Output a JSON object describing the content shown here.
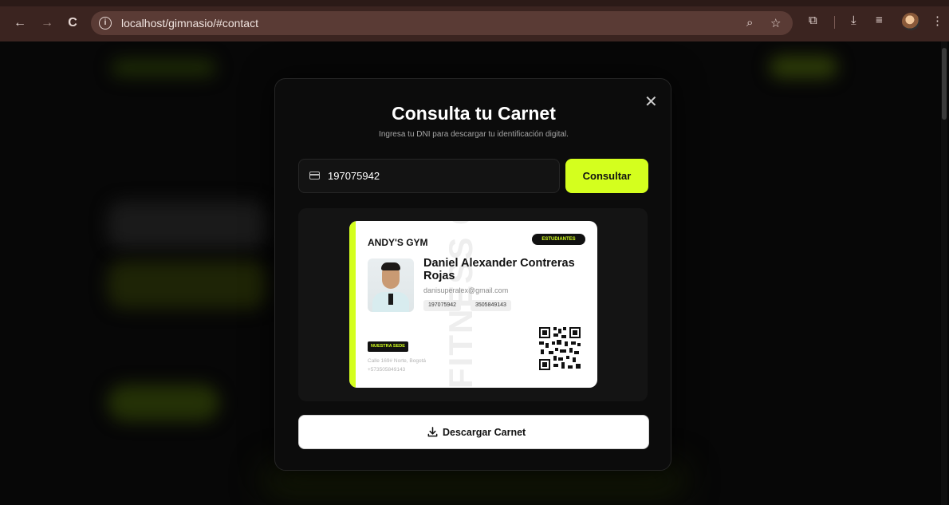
{
  "browser": {
    "url": "localhost/gimnasio/#contact",
    "nav_back": "←",
    "nav_forward": "→",
    "reload": "C"
  },
  "modal": {
    "title": "Consulta tu Carnet",
    "subtitle": "Ingresa tu DNI para descargar tu identificación digital.",
    "close_label": "✕",
    "dni_value": "197075942",
    "consult_button": "Consultar",
    "download_button": "Descargar Carnet"
  },
  "card": {
    "gym_name": "ANDY'S GYM",
    "badge": "ESTUDIANTES",
    "watermark": "FITNESS CAF",
    "member_name": "Daniel Alexander Contreras Rojas",
    "email": "danisuperalex@gmail.com",
    "dni": "197075942",
    "phone": "3505849143",
    "sede_label": "NUESTRA SEDE",
    "address_line1": "Calle 169# Norte, Bogotá",
    "address_line2": "+573505849143"
  },
  "colors": {
    "accent": "#d4ff1e",
    "background": "#0b0b0b",
    "chrome": "#3b2420"
  }
}
